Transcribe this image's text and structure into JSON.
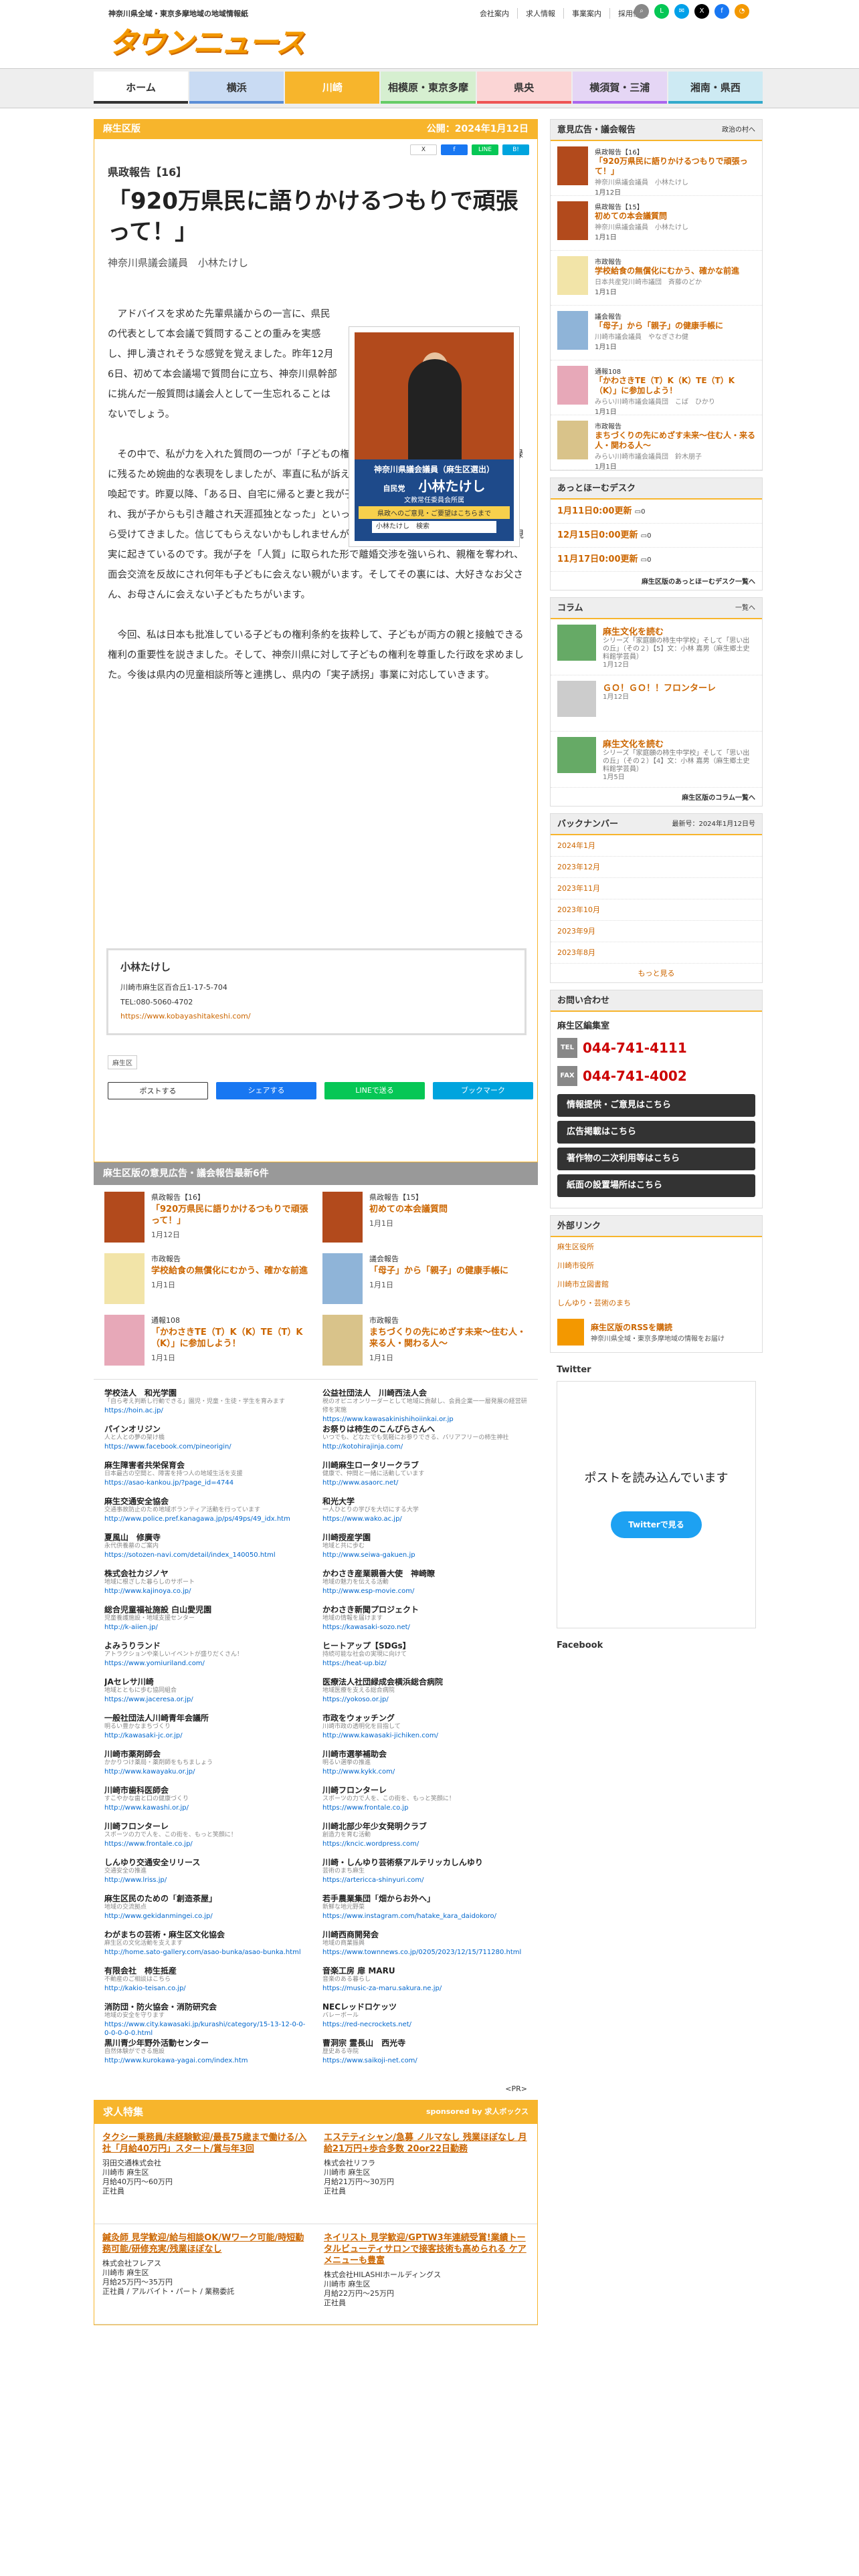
{
  "header": {
    "tagline": "神奈川県全域・東京多摩地域の地域情報紙",
    "logo": "タウンニュース",
    "links": [
      "会社案内",
      "求人情報",
      "事業案内",
      "採用情報"
    ]
  },
  "nav": {
    "items": [
      {
        "label": "ホーム",
        "color": "#333"
      },
      {
        "label": "横浜",
        "color": "#5b8ed6"
      },
      {
        "label": "川崎",
        "color": "#f7b52c"
      },
      {
        "label": "相模原・東京多摩",
        "color": "#6c6"
      },
      {
        "label": "県央",
        "color": "#e55"
      },
      {
        "label": "横須賀・三浦",
        "color": "#a6e"
      },
      {
        "label": "湘南・県西",
        "color": "#3ac"
      }
    ]
  },
  "article": {
    "edition": "麻生区版",
    "published": "公開：2024年1月12日",
    "series": "県政報告【16】",
    "title": "「920万県民に語りかけるつもりで頑張って！」",
    "author": "神奈川県議会議員　小林たけし",
    "paragraphs": [
      "アドバイスを求めた先輩県議からの一言に、県民の代表として本会議で質問することの重みを実感し、押し潰されそうな感覚を覚えました。昨年12月6日、初めて本会議場で質問台に立ち、神奈川県幹部に挑んだ一般質問は議会人として一生忘れることはないでしょう。",
      "その中で、私が力を入れた質問の一つが「子どもの権利の保障について」です。県議会議事録に残るため婉曲的な表現をしましたが、率直に私が訴えたかったことは「実子誘拐」への注意喚起です。昨夏以降、「ある日、自宅に帰ると妻と我が子が消えていた」「夫から暴力を振るわれ、我が子からも引き離され天涯孤独となった」といった相談を、麻生区民も含め広く県民から受けてきました。信じてもらえないかもしれませんが、このような驚くべき事件が日本では現実に起きているのです。我が子を「人質」に取られた形で離婚交渉を強いられ、親権を奪われ、面会交流を反故にされ何年も子どもに会えない親がいます。そしてその裏には、大好きなお父さん、お母さんに会えない子どもたちがいます。",
      "今回、私は日本も批准している子どもの権利条約を抜粋して、子どもが両方の親と接触できる権利の重要性を説きました。そして、神奈川県に対して子どもの権利を尊重した行政を求めました。今後は県内の児童相談所等と連携し、県内の「実子誘拐」事業に対応していきます。"
    ],
    "poster": {
      "line1": "神奈川県議会議員（麻生区選出）",
      "party": "自民党",
      "name": "小林たけし",
      "sub": "文教常任委員会所属",
      "banner": "県政へのご意見・ご要望はこちらまで",
      "search": "小林たけし　検索"
    },
    "profile": {
      "name": "小林たけし",
      "address": "川崎市麻生区百合丘1-17-5-704",
      "tel": "TEL:080-5060-4702",
      "url": "https://www.kobayashitakeshi.com/"
    },
    "tag": "麻生区",
    "share_top": [
      "X",
      "f",
      "LINE",
      "B!"
    ],
    "share_bottom": [
      "ポストする",
      "シェアする",
      "LINEで送る",
      "ブックマーク"
    ]
  },
  "latest": {
    "heading": "麻生区版の意見広告・議会報告最新6件",
    "items": [
      {
        "cat": "県政報告【16】",
        "title": "「920万県民に語りかけるつもりで頑張って！」",
        "date": "1月12日"
      },
      {
        "cat": "県政報告【15】",
        "title": "初めての本会議質問",
        "date": "1月1日"
      },
      {
        "cat": "市政報告",
        "title": "学校給食の無償化にむかう、確かな前進",
        "date": "1月1日"
      },
      {
        "cat": "議会報告",
        "title": "「母子」から「親子」の健康手帳に",
        "date": "1月1日"
      },
      {
        "cat": "通報108",
        "title": "「かわさきTE（T）K（K）TE（T）K（K）」に参加しよう！",
        "date": "1月1日"
      },
      {
        "cat": "市政報告",
        "title": "まちづくりの先にめざす未来〜住む人・来る人・関わる人〜",
        "date": "1月1日"
      }
    ]
  },
  "ads": [
    {
      "n": "学校法人　和光学園",
      "d": "「自ら考え判断し行動できる」園児・児童・生徒・学生を育みます",
      "u": "https://hoin.ac.jp/"
    },
    {
      "n": "公益社団法人　川崎西法人会",
      "d": "税のオピニオンリーダーとして地域に貢献し、会員企業一一層発展の経営研修を実施",
      "u": "https://www.kawasakinishihoiinkai.or.jp"
    },
    {
      "n": "パインオリジン",
      "d": "人と人との夢の架け橋",
      "u": "https://www.facebook.com/pineorigin/"
    },
    {
      "n": "お祭りは柿生のこんぴらさんへ",
      "d": "いつでも、どなたでも気軽にお参りできる、バリアフリーの柿生神社",
      "u": "http://kotohirajinja.com/"
    },
    {
      "n": "麻生障害者共栄保育会",
      "d": "日本最古の空間と、障害を持つ人の地域生活を支援",
      "u": "https://asao-kankou.jp/?page_id=4744"
    },
    {
      "n": "川崎麻生ロータリークラブ",
      "d": "健康で、仲間と一緒に活動しています",
      "u": "http://www.asaorc.net/"
    },
    {
      "n": "麻生交通安全協会",
      "d": "交通事故防止のため地域ボランティア活動を行っています",
      "u": "http://www.police.pref.kanagawa.jp/ps/49ps/49_idx.htm"
    },
    {
      "n": "和光大学",
      "d": "一人ひとりの学びを大切にする大学",
      "u": "https://www.wako.ac.jp/"
    },
    {
      "n": "夏風山　修廣寺",
      "d": "永代供養墓のご案内",
      "u": "https://sotozen-navi.com/detail/index_140050.html"
    },
    {
      "n": "川崎授産学園",
      "d": "地域と共に歩む",
      "u": "http://www.seiwa-gakuen.jp"
    },
    {
      "n": "株式会社カジノヤ",
      "d": "地域に根ざした暮らしのサポート",
      "u": "http://www.kajinoya.co.jp/"
    },
    {
      "n": "かわさき産業親善大使　神崎瞭",
      "d": "地域の魅力を伝える活動",
      "u": "http://www.esp-movie.com/"
    },
    {
      "n": "総合児童福祉施設 白山愛児園",
      "d": "児童養護施設・地域支援センター",
      "u": "http://k-aiien.jp/"
    },
    {
      "n": "かわさき新聞プロジェクト",
      "d": "地域の情報を届けます",
      "u": "https://kawasaki-sozo.net/"
    },
    {
      "n": "よみうりランド",
      "d": "アトラクションや楽しいイベントが盛りだくさん！",
      "u": "https://www.yomiuriland.com/"
    },
    {
      "n": "ヒートアップ【SDGs】",
      "d": "持続可能な社会の実現に向けて",
      "u": "https://heat-up.biz/"
    },
    {
      "n": "JAセレサ川崎",
      "d": "地域とともに歩む協同組合",
      "u": "https://www.jaceresa.or.jp/"
    },
    {
      "n": "医療法人社団緑成会横浜総合病院",
      "d": "地域医療を支える総合病院",
      "u": "https://yokoso.or.jp/"
    },
    {
      "n": "一般社団法人川崎青年会議所",
      "d": "明るい豊かなまちづくり",
      "u": "http://kawasaki-jc.or.jp/"
    },
    {
      "n": "市政をウォッチング",
      "d": "川崎市政の透明化を目指して",
      "u": "http://www.kawasaki-jichiken.com/"
    },
    {
      "n": "川崎市薬剤師会",
      "d": "かかりつけ薬局・薬剤師をもちましょう",
      "u": "http://www.kawayaku.or.jp/"
    },
    {
      "n": "川崎市選挙補助会",
      "d": "明るい選挙の推進",
      "u": "http://www.kykk.com/"
    },
    {
      "n": "川崎市歯科医師会",
      "d": "すこやかな歯と口の健康づくり",
      "u": "http://www.kawashi.or.jp/"
    },
    {
      "n": "川崎フロンターレ",
      "d": "スポーツの力で人を、この街を、もっと笑顔に！",
      "u": "https://www.frontale.co.jp"
    },
    {
      "n": "川崎フロンターレ",
      "d": "スポーツの力で人を、この街を、もっと笑顔に！",
      "u": "https://www.frontale.co.jp/"
    },
    {
      "n": "川崎北部少年少女発明クラブ",
      "d": "創造力を育む活動",
      "u": "https://kncic.wordpress.com/"
    },
    {
      "n": "しんゆり交通安全リリース",
      "d": "交通安全の推進",
      "u": "http://www.lriss.jp/"
    },
    {
      "n": "川崎・しんゆり芸術祭アルテリッカしんゆり",
      "d": "芸術のまち麻生",
      "u": "https://artericca-shinyuri.com/"
    },
    {
      "n": "麻生区民のための「創造茶屋」",
      "d": "地域の交流拠点",
      "u": "http://www.gekidanmingei.co.jp/"
    },
    {
      "n": "若手農業集団「畑からお外へ」",
      "d": "新鮮な地元野菜",
      "u": "https://www.instagram.com/hatake_kara_daidokoro/"
    },
    {
      "n": "わがまちの芸術・麻生区文化協会",
      "d": "麻生区の文化活動を支えます",
      "u": "http://home.sato-gallery.com/asao-bunka/asao-bunka.html"
    },
    {
      "n": "川崎西商開発会",
      "d": "地域の商業振興",
      "u": "https://www.townnews.co.jp/0205/2023/12/15/711280.html"
    },
    {
      "n": "有限会社　柿生抵産",
      "d": "不動産のご相談はこちら",
      "u": "http://kakio-teisan.co.jp/"
    },
    {
      "n": "音楽工房 扉 MARU",
      "d": "音楽のある暮らし",
      "u": "https://music-za-maru.sakura.ne.jp/"
    },
    {
      "n": "消防団・防火協会・消防研究会",
      "d": "地域の安全を守ります",
      "u": "https://www.city.kawasaki.jp/kurashi/category/15-13-12-0-0-0-0-0-0-0.html"
    },
    {
      "n": "NECレッドロケッツ",
      "d": "バレーボール",
      "u": "https://red-necrockets.net/"
    },
    {
      "n": "黒川青少年野外活動センター",
      "d": "自然体験ができる施設",
      "u": "http://www.kurokawa-yagai.com/index.htm"
    },
    {
      "n": "曹洞宗 霊長山　西光寺",
      "d": "歴史ある寺院",
      "u": "https://www.saikoji-net.com/"
    }
  ],
  "ads_next": "<PR>",
  "jobs": {
    "heading": "求人特集",
    "sponsor": "sponsored by 求人ボックス",
    "items": [
      {
        "title": "タクシー乗務員/未経験歓迎/最長75歳まで働ける/入社「月給40万円」スタート/賞与年3回",
        "company": "羽田交通株式会社",
        "place": "川崎市 麻生区",
        "pay": "月給40万円〜60万円",
        "type": "正社員"
      },
      {
        "title": "エステティシャン/急募 ノルマなし 残業ほぼなし 月給21万円+歩合多数 20or22日勤務",
        "company": "株式会社リフラ",
        "place": "川崎市 麻生区",
        "pay": "月給21万円〜30万円",
        "type": "正社員"
      },
      {
        "title": "鍼灸師 見学歓迎/給与相談OK/Wワーク可能/時短勤務可能/研修充実/残業ほぼなし",
        "company": "株式会社フレアス",
        "place": "川崎市 麻生区",
        "pay": "月給25万円〜35万円",
        "type": "正社員 / アルバイト・パート / 業務委託"
      },
      {
        "title": "ネイリスト 見学歓迎/GPTW3年連続受賞!業績トータルビューティサロンで接客技術も高められる ケアメニューも豊富",
        "company": "株式会社HILASHIホールディングス",
        "place": "川崎市 麻生区",
        "pay": "月給22万円〜25万円",
        "type": "正社員"
      }
    ]
  },
  "side": {
    "opinion": {
      "heading": "意見広告・議会報告",
      "sub": "政治の村へ",
      "items": [
        {
          "cat": "県政報告【16】",
          "title": "「920万県民に語りかけるつもりで頑張って！」",
          "author": "神奈川県議会議員　小林たけし",
          "date": "1月12日"
        },
        {
          "cat": "県政報告【15】",
          "title": "初めての本会議質問",
          "author": "神奈川県議会議員　小林たけし",
          "date": "1月1日"
        },
        {
          "cat": "市政報告",
          "title": "学校給食の無償化にむかう、確かな前進",
          "author": "日本共産党川崎市議団　斉藤のどか",
          "date": "1月1日"
        },
        {
          "cat": "議会報告",
          "title": "「母子」から「親子」の健康手帳に",
          "author": "川崎市議会議員　やなぎさわ健",
          "date": "1月1日"
        },
        {
          "cat": "通報108",
          "title": "「かわさきTE（T）K（K）TE（T）K（K）」に参加しよう！",
          "author": "みらい川崎市議会議員団　こば　ひかり",
          "date": "1月1日"
        },
        {
          "cat": "市政報告",
          "title": "まちづくりの先にめざす未来〜住む人・来る人・関わる人〜",
          "author": "みらい川崎市議会議員団　鈴木朋子",
          "date": "1月1日"
        }
      ]
    },
    "desk": {
      "heading": "あっとほーむデスク",
      "items": [
        "1月11日0:00更新",
        "12月15日0:00更新",
        "11月17日0:00更新"
      ],
      "counts": [
        "0",
        "0",
        "0"
      ],
      "more": "麻生区版のあっとほーむデスク一覧へ"
    },
    "column": {
      "heading": "コラム",
      "more_top": "一覧へ",
      "items": [
        {
          "title": "麻生文化を読む",
          "sub": "シリーズ「家庭願の柿生中学校」そして「思い出の丘」（その２）【5】文：小林 嘉男（麻生郷土史料館学芸員）",
          "date": "1月12日"
        },
        {
          "title": "ＧＯ！ＧＯ！！フロンターレ",
          "sub": "",
          "date": "1月12日"
        },
        {
          "title": "麻生文化を読む",
          "sub": "シリーズ「家庭願の柿生中学校」そして「思い出の丘」（その２）【4】文：小林 嘉男（麻生郷土史料館学芸員）",
          "date": "1月5日"
        }
      ],
      "more": "麻生区版のコラム一覧へ"
    },
    "backnumber": {
      "heading": "バックナンバー",
      "latest": "最新号：2024年1月12日号",
      "items": [
        "2024年1月",
        "2023年12月",
        "2023年11月",
        "2023年10月",
        "2023年9月",
        "2023年8月"
      ],
      "more": "もっと見る"
    },
    "contact": {
      "heading": "お問い合わせ",
      "name": "麻生区編集室",
      "tel_label": "TEL",
      "tel": "044-741-4111",
      "fax_label": "FAX",
      "fax": "044-741-4002",
      "buttons": [
        "情報提供・ご意見はこちら",
        "広告掲載はこちら",
        "著作物の二次利用等はこちら",
        "紙面の設置場所はこちら"
      ]
    },
    "external": {
      "heading": "外部リンク",
      "items": [
        "麻生区役所",
        "川崎市役所",
        "川崎市立図書館",
        "しんゆり・芸術のまち"
      ]
    },
    "rss": {
      "title": "麻生区版のRSSを購読",
      "sub": "神奈川県全域・東京多摩地域の情報をお届け"
    },
    "twitter": {
      "heading": "Twitter",
      "text": "ポストを読み込んでいます",
      "button": "Twitterで見る"
    },
    "facebook": {
      "heading": "Facebook"
    }
  }
}
